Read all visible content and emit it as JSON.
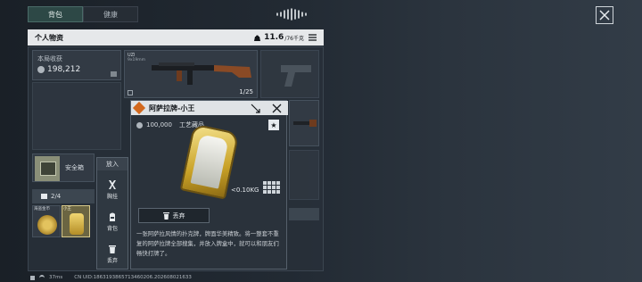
{
  "tabs": [
    {
      "label": "背包"
    },
    {
      "label": "健康"
    }
  ],
  "inventory": {
    "title": "个人物资",
    "weight_value": "11.6",
    "weight_max": "/76千克"
  },
  "income": {
    "label": "本局收获",
    "value": "198,212"
  },
  "weapon": {
    "name": "UZI",
    "ammo_type": "9x19mm",
    "ammo_count": "1/25"
  },
  "safe_box": {
    "label": "安全箱",
    "count": "2/4",
    "item1_label": "海盗金币",
    "item2_label": "小王"
  },
  "context_menu": {
    "header": "放入",
    "items": [
      {
        "label": "胸挂"
      },
      {
        "label": "背包"
      },
      {
        "label": "丢弃"
      }
    ]
  },
  "item_popup": {
    "title": "阿萨拉牌-小王",
    "value": "100,000",
    "category": "工艺藏品",
    "weight": "<0.10KG",
    "discard_label": "丢弃",
    "description": "一张阿萨拉风情的扑克牌，牌面华美精致。将一整套不重复的阿萨拉牌全部搜集，并放入牌盒中，就可以和朋友们畅快打牌了。"
  },
  "status_bar": {
    "ping": "37ms",
    "uid": "CN UID:1863193865713460206.202608021633"
  },
  "colors": {
    "accent": "#2d4846",
    "header_bg": "#e6e8ea",
    "gold": "#c9a227"
  }
}
